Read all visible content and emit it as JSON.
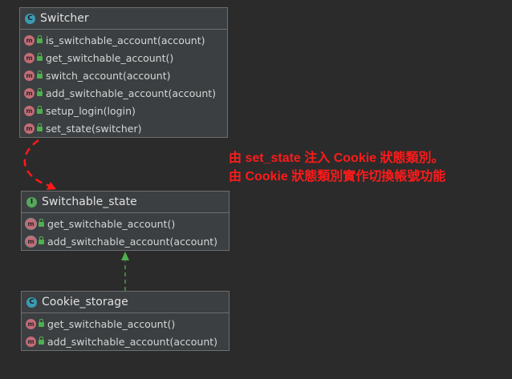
{
  "classes": {
    "switcher": {
      "name": "Switcher",
      "kind_icon": "C",
      "methods": [
        "is_switchable_account(account)",
        "get_switchable_account()",
        "switch_account(account)",
        "add_switchable_account(account)",
        "setup_login(login)",
        "set_state(switcher)"
      ]
    },
    "switchable_state": {
      "name": "Switchable_state",
      "kind_icon": "I",
      "methods": [
        "get_switchable_account()",
        "add_switchable_account(account)"
      ]
    },
    "cookie_storage": {
      "name": "Cookie_storage",
      "kind_icon": "C",
      "methods": [
        "get_switchable_account()",
        "add_switchable_account(account)"
      ]
    }
  },
  "method_icon": "m",
  "annotation": {
    "line1": "由 set_state 注入 Cookie 狀態類別。",
    "line2": "由 Cookie 狀態類別實作切換帳號功能"
  },
  "colors": {
    "background": "#2b2b2b",
    "annotation_text": "#ff1a1a",
    "dependency_arrow": "#ff1a1a",
    "realization_arrow": "#4eb04e",
    "class_icon": "#3b9bb5",
    "interface_icon": "#55a85b",
    "method_icon": "#c46b76"
  }
}
